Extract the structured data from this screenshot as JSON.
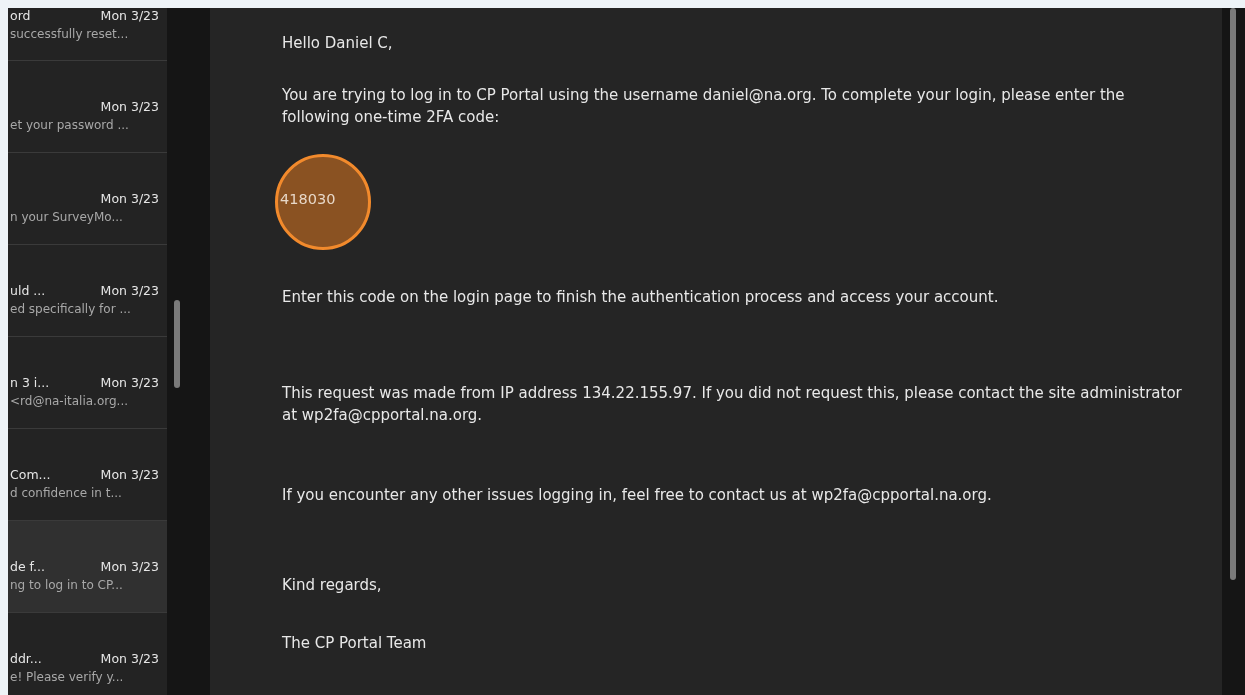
{
  "message_list": [
    {
      "title": "ord",
      "date": "Mon 3/23",
      "preview": "successfully reset...",
      "selected": false
    },
    {
      "date": "Mon 3/23",
      "preview": "et your password ...",
      "selected": false
    },
    {
      "date": "Mon 3/23",
      "preview": "n your SurveyMo...",
      "selected": false
    },
    {
      "title": "uld ...",
      "date": "Mon 3/23",
      "preview": "ed specifically for ...",
      "selected": false
    },
    {
      "title": "n 3 i...",
      "date": "Mon 3/23",
      "preview": "<rd@na-italia.org...",
      "selected": false
    },
    {
      "title": "Com...",
      "date": "Mon 3/23",
      "preview": "d confidence in t...",
      "selected": false
    },
    {
      "title": "de f...",
      "date": "Mon 3/23",
      "preview": "ng to log in to CP...",
      "selected": true
    },
    {
      "title": "ddr...",
      "date": "Mon 3/23",
      "preview": "e! Please verify y...",
      "selected": false
    }
  ],
  "email_body": [
    {
      "kind": "paragraph",
      "text": "Hello Daniel C,"
    },
    {
      "kind": "paragraph",
      "text": "You are trying to log in to CP Portal using the username daniel@na.org. To complete your login, please enter the following one-time 2FA code:"
    },
    {
      "kind": "code",
      "text": "418030",
      "highlighted": true
    },
    {
      "kind": "paragraph",
      "text": "Enter this code on the login page to finish the authentication process and access your account."
    },
    {
      "kind": "paragraph",
      "text": "This request was made from IP address 134.22.155.97. If you did not request this, please contact the site administrator at wp2fa@cpportal.na.org."
    },
    {
      "kind": "paragraph",
      "text": "If you encounter any other issues logging in, feel free to contact us at wp2fa@cpportal.na.org."
    },
    {
      "kind": "closing",
      "text": "Kind regards,"
    },
    {
      "kind": "closing",
      "text": "The CP Portal Team"
    }
  ]
}
